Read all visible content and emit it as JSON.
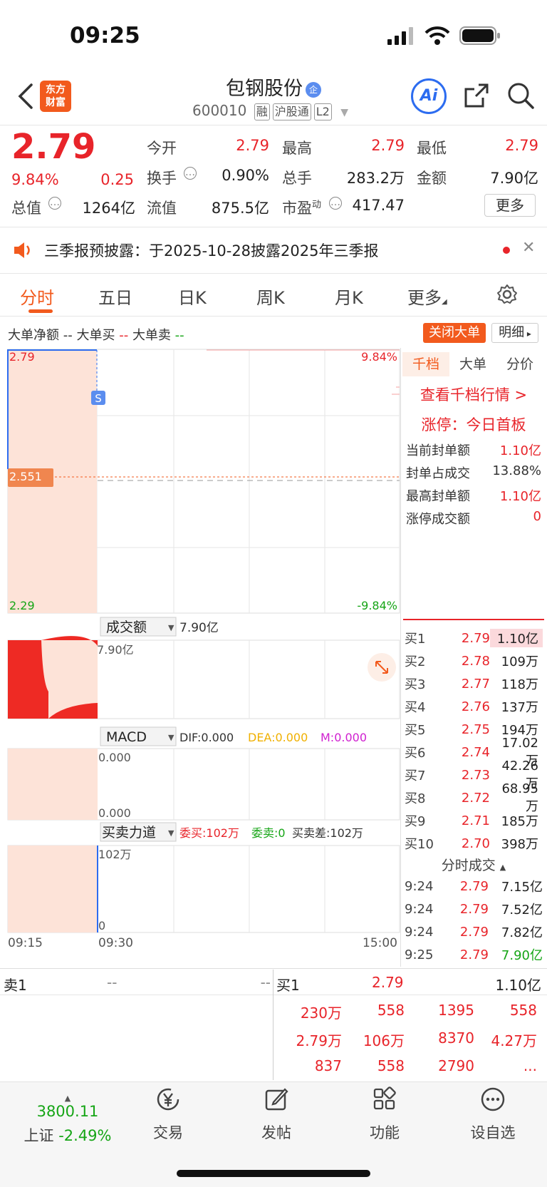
{
  "status_bar": {
    "time": "09:25"
  },
  "header": {
    "logo_line1": "东方",
    "logo_line2": "财富",
    "stock_name": "包钢股份",
    "name_badge": "企",
    "stock_code": "600010",
    "tags": [
      "融",
      "沪股通",
      "L2"
    ],
    "ai_label": "Ai"
  },
  "quote": {
    "price": "2.79",
    "change_pct": "9.84%",
    "change_amt": "0.25",
    "fields": [
      {
        "label": "今开",
        "value": "2.79",
        "color": "red"
      },
      {
        "label": "最高",
        "value": "2.79",
        "color": "red"
      },
      {
        "label": "最低",
        "value": "2.79",
        "color": "red"
      },
      {
        "label": "换手",
        "value": "0.90%",
        "color": "black"
      },
      {
        "label": "总手",
        "value": "283.2万",
        "color": "black"
      },
      {
        "label": "金额",
        "value": "7.90亿",
        "color": "black"
      },
      {
        "label": "总值",
        "value": "1264亿",
        "color": "black"
      },
      {
        "label": "流值",
        "value": "875.5亿",
        "color": "black"
      },
      {
        "label": "市盈",
        "value": "417.47",
        "color": "black"
      }
    ],
    "pe_sup": "动",
    "more_label": "更多"
  },
  "notice": {
    "text": "三季报预披露：于2025-10-28披露2025年三季报",
    "close": "✕"
  },
  "tabs": [
    "分时",
    "五日",
    "日K",
    "周K",
    "月K",
    "更多"
  ],
  "legend": {
    "net": "大单净额",
    "net_v": "--",
    "buy": "大单买",
    "buy_v": "--",
    "sell": "大单卖",
    "sell_v": "--",
    "close_btn": "关闭大单",
    "detail_btn": "明细"
  },
  "chart": {
    "price_top": "2.79",
    "price_bottom": "2.29",
    "pct_top": "9.84%",
    "pct_bottom": "-9.84%",
    "avg_label": "2.551",
    "s_marker": "S",
    "amount_selector": "成交额",
    "amount_value": "7.90亿",
    "amount_axis": "7.90亿",
    "macd_selector": "MACD",
    "dif": "DIF:0.000",
    "dea": "DEA:0.000",
    "m": "M:0.000",
    "macd_top": "0.000",
    "macd_bottom": "0.000",
    "force_selector": "买卖力道",
    "force_buy": "委买:102万",
    "force_sell": "委卖:0",
    "force_diff": "买卖差:102万",
    "force_top": "102万",
    "force_bottom": "0",
    "time_start": "09:15",
    "time_open": "09:30",
    "time_end": "15:00",
    "colors": {
      "up": "#e8242a",
      "down": "#16a516",
      "fill": "#fde3d8",
      "accent": "#f25a1d"
    }
  },
  "right_panel": {
    "tabs": [
      "千档",
      "大单",
      "分价"
    ],
    "view_link": "查看千档行情 >",
    "limit_title": "涨停：今日首板",
    "stats": [
      {
        "label": "当前封单额",
        "value": "1.10亿",
        "color": "red"
      },
      {
        "label": "封单占成交",
        "value": "13.88%",
        "color": "black"
      },
      {
        "label": "最高封单额",
        "value": "1.10亿",
        "color": "red"
      },
      {
        "label": "涨停成交额",
        "value": "0",
        "color": "red"
      }
    ],
    "bids": [
      {
        "label": "买1",
        "price": "2.79",
        "vol": "1.10亿"
      },
      {
        "label": "买2",
        "price": "2.78",
        "vol": "109万"
      },
      {
        "label": "买3",
        "price": "2.77",
        "vol": "118万"
      },
      {
        "label": "买4",
        "price": "2.76",
        "vol": "137万"
      },
      {
        "label": "买5",
        "price": "2.75",
        "vol": "194万"
      },
      {
        "label": "买6",
        "price": "2.74",
        "vol": "17.02万"
      },
      {
        "label": "买7",
        "price": "2.73",
        "vol": "42.26万"
      },
      {
        "label": "买8",
        "price": "2.72",
        "vol": "68.95万"
      },
      {
        "label": "买9",
        "price": "2.71",
        "vol": "185万"
      },
      {
        "label": "买10",
        "price": "2.70",
        "vol": "398万"
      }
    ],
    "ticks_title": "分时成交",
    "ticks": [
      {
        "time": "9:24",
        "price": "2.79",
        "vol": "7.15亿",
        "color": "red"
      },
      {
        "time": "9:24",
        "price": "2.79",
        "vol": "7.52亿",
        "color": "red"
      },
      {
        "time": "9:24",
        "price": "2.79",
        "vol": "7.82亿",
        "color": "red"
      },
      {
        "time": "9:25",
        "price": "2.79",
        "vol": "7.90亿",
        "color": "green"
      }
    ]
  },
  "strip": {
    "sell1_label": "卖1",
    "sell1_price": "--",
    "sell1_vol": "--",
    "buy1_label": "买1",
    "buy1_price": "2.79",
    "buy1_vol": "1.10亿",
    "rows": [
      [
        "230万",
        "558",
        "1395",
        "558"
      ],
      [
        "2.79万",
        "106万",
        "8370",
        "4.27万"
      ],
      [
        "837",
        "558",
        "2790",
        "..."
      ]
    ]
  },
  "nav": {
    "index_value": "3800.11",
    "index_name": "上证",
    "index_pct": "-2.49%",
    "items": [
      "交易",
      "发帖",
      "功能",
      "设自选"
    ]
  }
}
